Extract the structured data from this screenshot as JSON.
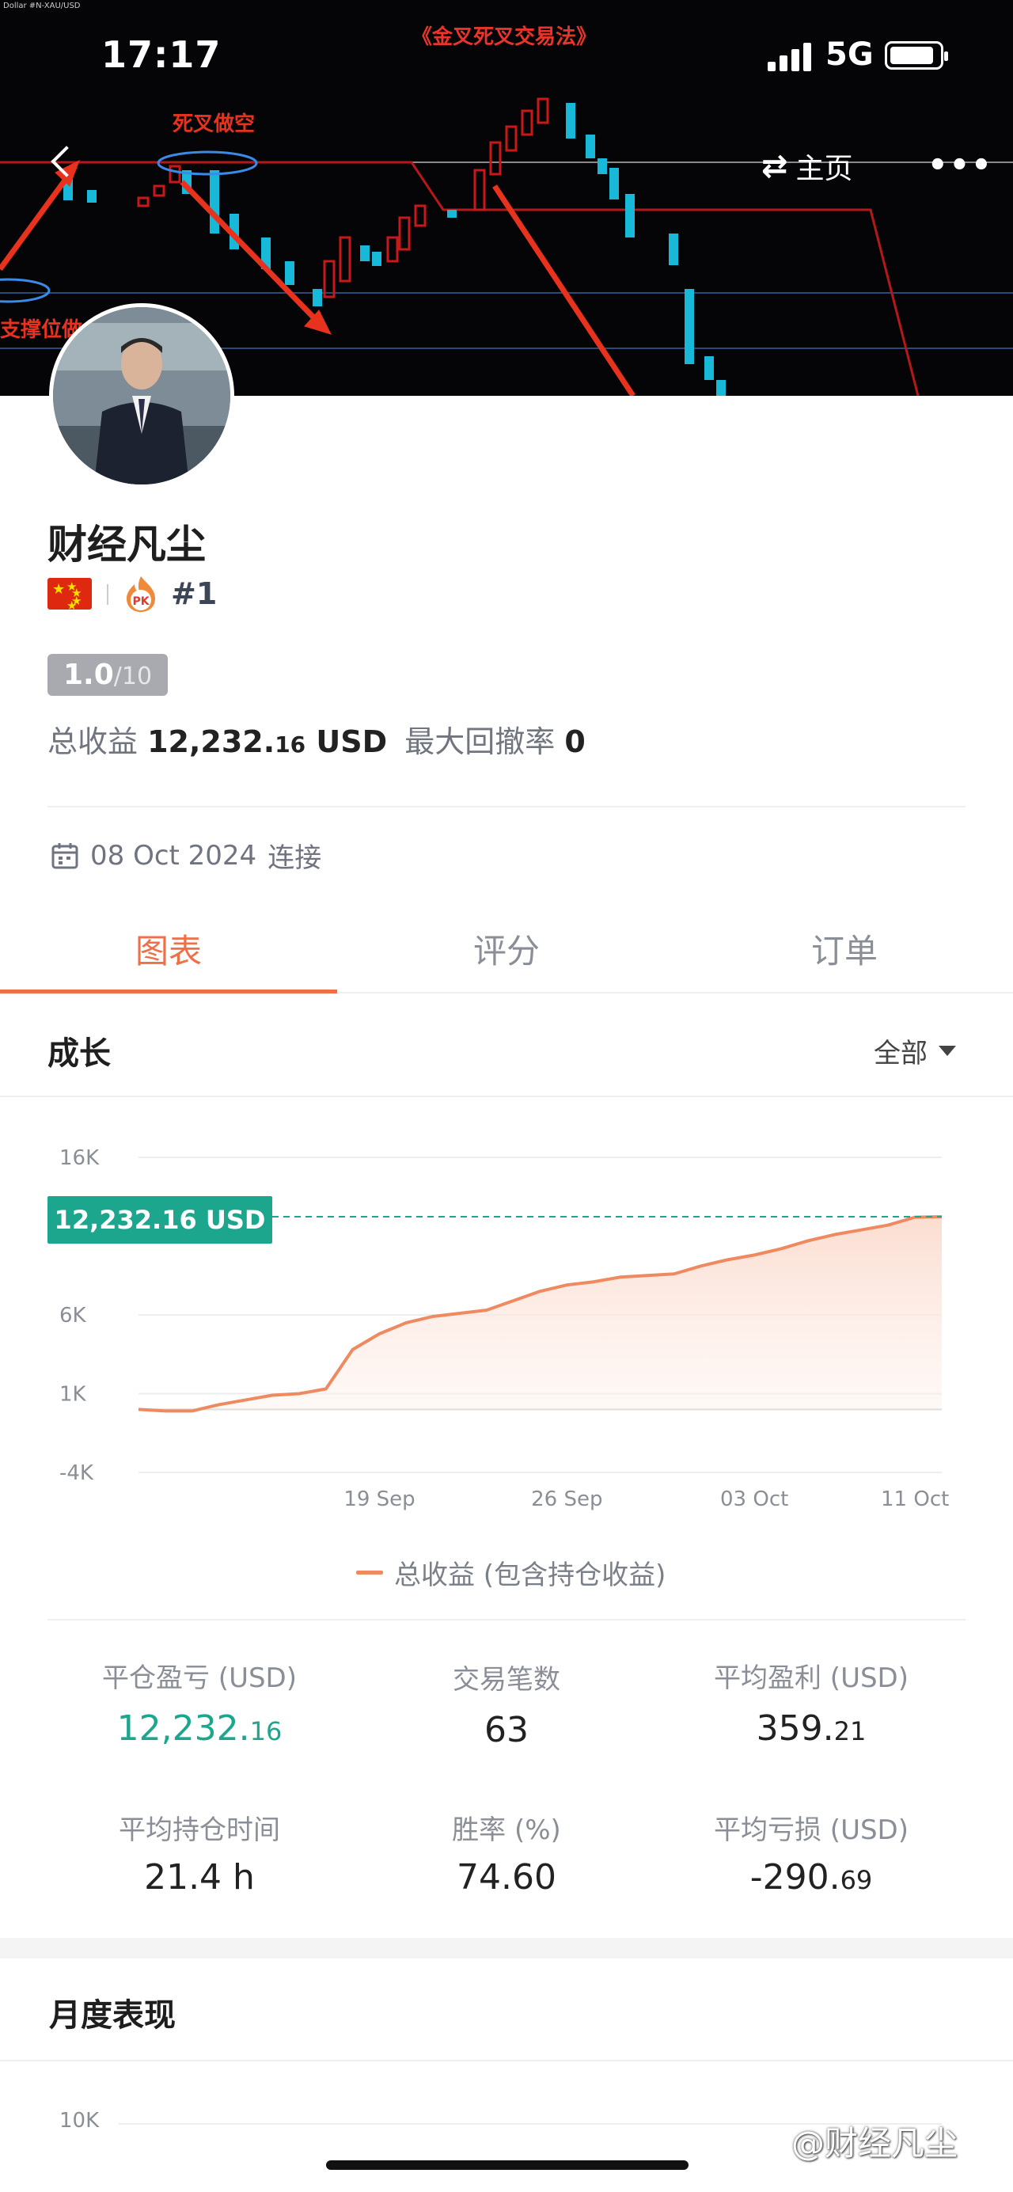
{
  "status_bar": {
    "time": "17:17",
    "network": "5G"
  },
  "banner": {
    "title": "《金叉死叉交易法》",
    "label_dead_cross": "死叉做空",
    "label_support": "支撑位做",
    "tiny_text": "Dollar #N-XAU/USD"
  },
  "header": {
    "home_label": "主页"
  },
  "profile": {
    "name": "财经凡尘",
    "rank": "#1",
    "score": "1.0",
    "score_max": "/10",
    "profit_label": "总收益",
    "profit_main": "12,232.",
    "profit_dec": "16",
    "profit_unit": "USD",
    "drawdown_label": "最大回撤率",
    "drawdown_value": "0",
    "date": "08 Oct 2024",
    "date_suffix": "连接"
  },
  "tabs": [
    "图表",
    "评分",
    "订单"
  ],
  "growth": {
    "title": "成长",
    "filter": "全部",
    "value_tag": "12,232.16 USD",
    "legend": "总收益 (包含持仓收益)"
  },
  "chart_data": {
    "type": "area",
    "y_ticks": [
      "16K",
      "6K",
      "1K",
      "-4K"
    ],
    "ylim": [
      -4000,
      16000
    ],
    "x_ticks": [
      "19 Sep",
      "26 Sep",
      "03 Oct",
      "11 Oct"
    ],
    "x_tick_positions": [
      9,
      16,
      23,
      29
    ],
    "series": [
      {
        "name": "总收益 (包含持仓收益)",
        "x": [
          0,
          1,
          2,
          3,
          4,
          5,
          6,
          7,
          8,
          9,
          10,
          11,
          12,
          13,
          14,
          15,
          16,
          17,
          18,
          19,
          20,
          21,
          22,
          23,
          24,
          25,
          26,
          27,
          28,
          29,
          30
        ],
        "values": [
          0,
          -100,
          -100,
          300,
          600,
          900,
          1000,
          1300,
          3800,
          4800,
          5500,
          5900,
          6100,
          6300,
          6900,
          7500,
          7900,
          8100,
          8400,
          8500,
          8600,
          9100,
          9500,
          9800,
          10200,
          10700,
          11100,
          11400,
          11700,
          12200,
          12232
        ]
      }
    ],
    "reference_value": 12232.16,
    "colors": {
      "line": "#ef8a60",
      "fill": "#fde6dc",
      "reference": "#1da68e"
    }
  },
  "stats": [
    {
      "label": "平仓盈亏 (USD)",
      "main": "12,232.",
      "dec": "16",
      "highlight": true
    },
    {
      "label": "交易笔数",
      "main": "63",
      "dec": ""
    },
    {
      "label": "平均盈利 (USD)",
      "main": "359.",
      "dec": "21"
    },
    {
      "label": "平均持仓时间",
      "main": "21.4 h",
      "dec": ""
    },
    {
      "label": "胜率 (%)",
      "main": "74.60",
      "dec": ""
    },
    {
      "label": "平均亏损 (USD)",
      "main": "-290.",
      "dec": "69"
    }
  ],
  "monthly": {
    "title": "月度表现",
    "y_tick": "10K"
  },
  "watermark": "@财经凡尘"
}
